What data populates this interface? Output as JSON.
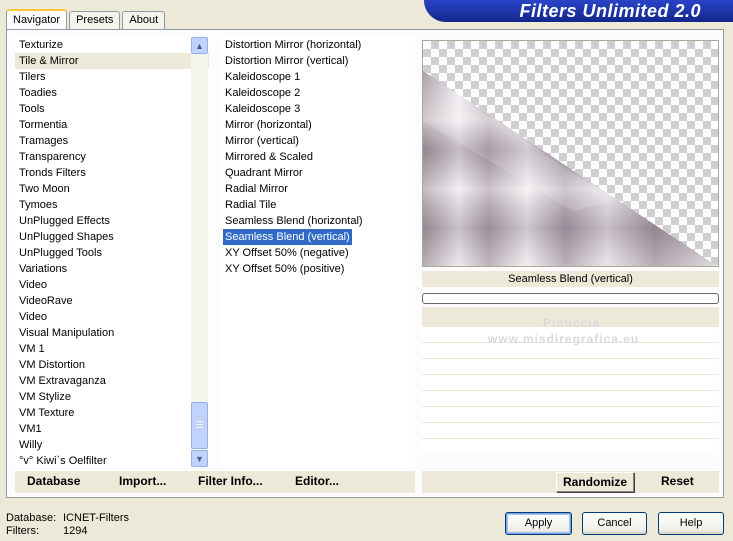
{
  "title": "Filters Unlimited 2.0",
  "tabs": [
    {
      "label": "Navigator",
      "active": true
    },
    {
      "label": "Presets",
      "active": false
    },
    {
      "label": "About",
      "active": false
    }
  ],
  "categories": [
    "Texturize",
    "Tile & Mirror",
    "Tilers",
    "Toadies",
    "Tools",
    "Tormentia",
    "Tramages",
    "Transparency",
    "Tronds Filters",
    "Two Moon",
    "Tymoes",
    "UnPlugged Effects",
    "UnPlugged Shapes",
    "UnPlugged Tools",
    "Variations",
    "Video",
    "VideoRave",
    "Video",
    "Visual Manipulation",
    "VM 1",
    "VM Distortion",
    "VM Extravaganza",
    "VM Stylize",
    "VM Texture",
    "VM1",
    "Willy",
    "°v° Kiwi`s Oelfilter"
  ],
  "selected_category": "Tile & Mirror",
  "filters": [
    "Distortion Mirror (horizontal)",
    "Distortion Mirror (vertical)",
    "Kaleidoscope 1",
    "Kaleidoscope 2",
    "Kaleidoscope 3",
    "Mirror (horizontal)",
    "Mirror (vertical)",
    "Mirrored & Scaled",
    "Quadrant Mirror",
    "Radial Mirror",
    "Radial Tile",
    "Seamless Blend (horizontal)",
    "Seamless Blend (vertical)",
    "XY Offset 50% (negative)",
    "XY Offset 50% (positive)"
  ],
  "selected_filter": "Seamless Blend (vertical)",
  "preview": {
    "filter_name": "Seamless Blend (vertical)"
  },
  "watermark": {
    "line1": "Pinuccia",
    "line2": "www.misdiregrafica.eu"
  },
  "left_buttons": {
    "database": "Database",
    "import": "Import...",
    "filter_info": "Filter Info...",
    "editor": "Editor..."
  },
  "right_buttons": {
    "randomize": "Randomize",
    "reset": "Reset"
  },
  "footer": {
    "database_label": "Database:",
    "database_value": "ICNET-Filters",
    "filters_label": "Filters:",
    "filters_value": "1294"
  },
  "dialog_buttons": {
    "apply": "Apply",
    "cancel": "Cancel",
    "help": "Help"
  },
  "colors": {
    "banner": "#1c2f9c",
    "selection": "#316ac5",
    "accent_tab": "#ffc83c",
    "window_bg": "#ece9d8"
  }
}
